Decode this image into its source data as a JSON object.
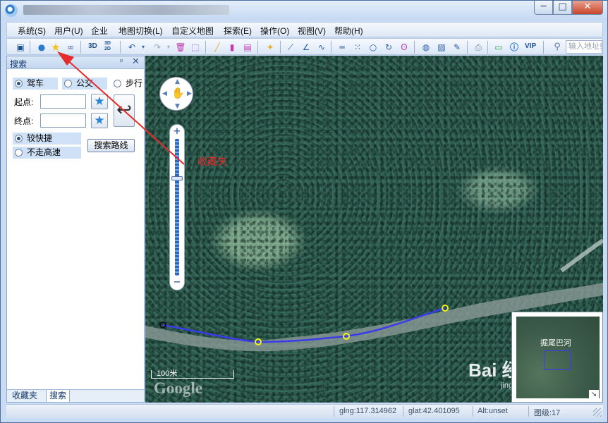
{
  "window": {
    "min_glyph": "─",
    "max_glyph": "□",
    "close_glyph": "✕"
  },
  "menu": [
    "系统(S)",
    "用户(U)",
    "企业",
    "地图切换(L)",
    "自定义地图",
    "探索(E)",
    "操作(O)",
    "视图(V)",
    "帮助(H)"
  ],
  "toolbar": {
    "text_3d": "3D",
    "text_3d2d": "3D/2D",
    "vip": "VIP",
    "address_placeholder": "输入地址或"
  },
  "left_panel": {
    "title": "搜索",
    "pin_glyph": "ᵖ",
    "close_glyph": "✕",
    "modes": {
      "drive": "驾车",
      "bus": "公交",
      "walk": "步行"
    },
    "start_label": "起点:",
    "end_label": "终点:",
    "route_options": {
      "fast": "较快捷",
      "no_highway": "不走高速"
    },
    "search_route_button": "搜索路线",
    "tabs": [
      "收藏夹",
      "搜索"
    ]
  },
  "map": {
    "scale_label": "100米",
    "provider_logo": "Google",
    "overview_label": "掘尾巴河",
    "watermark": "Bai 经验",
    "watermark_sub": "jingyan.baidu.com"
  },
  "annotation": {
    "text": "收藏夹",
    "color": "#e52b2b"
  },
  "status": {
    "lng": "glng:117.314962",
    "lat": "glat:42.401095",
    "alt": "Alt:unset",
    "zoom": "图级:17"
  },
  "colors": {
    "route_line": "#3b3bea",
    "waypoint": "#f2f21a",
    "frame": "#c9dcf3"
  }
}
